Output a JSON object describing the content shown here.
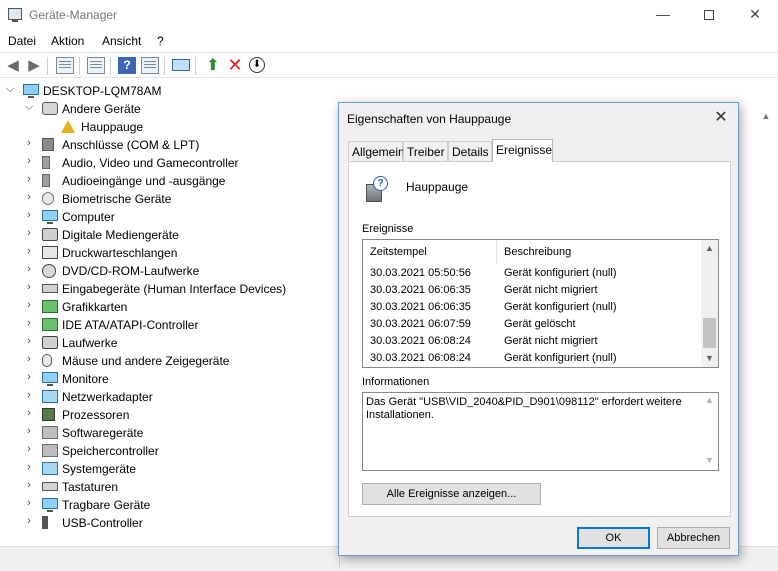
{
  "window": {
    "title": "Geräte-Manager",
    "min_glyph": "—",
    "close_glyph": "✕"
  },
  "menu": [
    "Datei",
    "Aktion",
    "Ansicht",
    "?"
  ],
  "toolbar_icons": [
    "back-arrow-icon",
    "forward-arrow-icon",
    "show-hide-icon",
    "properties-icon",
    "help-icon",
    "view-icon",
    "scan-hardware-icon",
    "update-driver-icon",
    "uninstall-icon",
    "disable-icon"
  ],
  "tree": {
    "root": "DESKTOP-LQM78AM",
    "other_group": "Andere Geräte",
    "other_child": "Hauppauge",
    "categories": [
      {
        "label": "Anschlüsse (COM & LPT)",
        "icon": "port-icon"
      },
      {
        "label": "Audio, Video und Gamecontroller",
        "icon": "audio-icon"
      },
      {
        "label": "Audioeingänge und -ausgänge",
        "icon": "speaker-icon"
      },
      {
        "label": "Biometrische Geräte",
        "icon": "fingerprint-icon"
      },
      {
        "label": "Computer",
        "icon": "computer-icon"
      },
      {
        "label": "Digitale Mediengeräte",
        "icon": "media-device-icon"
      },
      {
        "label": "Druckwarteschlangen",
        "icon": "printer-icon"
      },
      {
        "label": "DVD/CD-ROM-Laufwerke",
        "icon": "optical-drive-icon"
      },
      {
        "label": "Eingabegeräte (Human Interface Devices)",
        "icon": "hid-icon"
      },
      {
        "label": "Grafikkarten",
        "icon": "graphics-card-icon"
      },
      {
        "label": "IDE ATA/ATAPI-Controller",
        "icon": "ide-controller-icon"
      },
      {
        "label": "Laufwerke",
        "icon": "disk-drive-icon"
      },
      {
        "label": "Mäuse und andere Zeigegeräte",
        "icon": "mouse-icon"
      },
      {
        "label": "Monitore",
        "icon": "monitor-icon"
      },
      {
        "label": "Netzwerkadapter",
        "icon": "network-adapter-icon"
      },
      {
        "label": "Prozessoren",
        "icon": "processor-icon"
      },
      {
        "label": "Softwaregeräte",
        "icon": "software-device-icon"
      },
      {
        "label": "Speichercontroller",
        "icon": "storage-controller-icon"
      },
      {
        "label": "Systemgeräte",
        "icon": "system-device-icon"
      },
      {
        "label": "Tastaturen",
        "icon": "keyboard-icon"
      },
      {
        "label": "Tragbare Geräte",
        "icon": "portable-device-icon"
      },
      {
        "label": "USB-Controller",
        "icon": "usb-icon"
      }
    ]
  },
  "dialog": {
    "title": "Eigenschaften von Hauppauge",
    "tabs": [
      "Allgemein",
      "Treiber",
      "Details",
      "Ereignisse"
    ],
    "active_tab": "Ereignisse",
    "device_name": "Hauppauge",
    "events_label": "Ereignisse",
    "events_columns": [
      "Zeitstempel",
      "Beschreibung"
    ],
    "events": [
      {
        "time": "30.03.2021 05:50:56",
        "desc": "Gerät konfiguriert (null)"
      },
      {
        "time": "30.03.2021 06:06:35",
        "desc": "Gerät nicht migriert"
      },
      {
        "time": "30.03.2021 06:06:35",
        "desc": "Gerät konfiguriert (null)"
      },
      {
        "time": "30.03.2021 06:07:59",
        "desc": "Gerät gelöscht"
      },
      {
        "time": "30.03.2021 06:08:24",
        "desc": "Gerät nicht migriert"
      },
      {
        "time": "30.03.2021 06:08:24",
        "desc": "Gerät konfiguriert (null)"
      }
    ],
    "info_label": "Informationen",
    "info_text": "Das Gerät \"USB\\VID_2040&PID_D901\\098112\" erfordert weitere Installationen.",
    "all_events_button": "Alle Ereignisse anzeigen...",
    "ok_button": "OK",
    "cancel_button": "Abbrechen"
  }
}
